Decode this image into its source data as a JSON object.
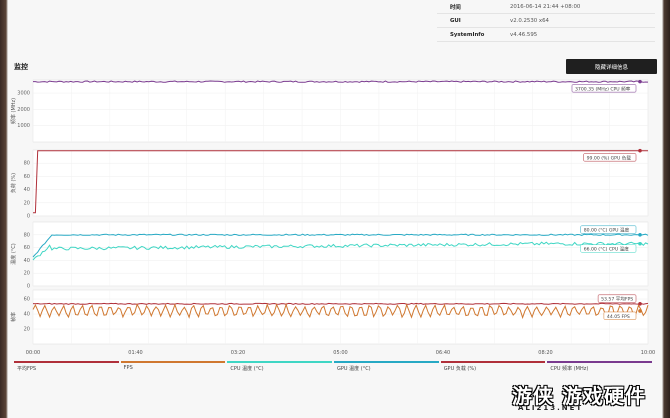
{
  "info": [
    {
      "key": "时间",
      "value": "2016-06-14 21:44 +08:00"
    },
    {
      "key": "GUI",
      "value": "v2.0.2530 x64"
    },
    {
      "key": "SystemInfo",
      "value": "v4.46.595"
    }
  ],
  "section_title": "监控",
  "hide_button_label": "隐藏详细信息",
  "colors": {
    "cpu_freq": "#7a3a8f",
    "gpu_load": "#b0303a",
    "gpu_temp": "#27a9c4",
    "cpu_temp": "#3fd6c4",
    "fps": "#d07830",
    "avg_fps": "#b0303a"
  },
  "chart_data": [
    {
      "type": "line",
      "ylabel": "频率 (MHz)",
      "yticks": [
        1000,
        2000,
        3000
      ],
      "ylim": [
        0,
        3800
      ],
      "series": [
        {
          "name": "CPU 频率",
          "value": 3700,
          "callout": "3700.35 (MHz) CPU 频率"
        }
      ]
    },
    {
      "type": "line",
      "ylabel": "负荷 (%)",
      "yticks": [
        0,
        20,
        40,
        60,
        80
      ],
      "ylim": [
        0,
        100
      ],
      "series": [
        {
          "name": "GPU 负载",
          "value": 99,
          "callout": "99.00 (%) GPU 负载"
        }
      ]
    },
    {
      "type": "line",
      "ylabel": "温度 (°C)",
      "yticks": [
        0,
        20,
        40,
        60,
        80
      ],
      "ylim": [
        0,
        100
      ],
      "series": [
        {
          "name": "GPU 温度",
          "value": 80,
          "callout": "80.00 (°C) GPU 温度"
        },
        {
          "name": "CPU 温度",
          "value": 66,
          "callout": "66.00 (°C) CPU 温度"
        }
      ]
    },
    {
      "type": "line",
      "ylabel": "帧率",
      "yticks": [
        20,
        40,
        60
      ],
      "ylim": [
        0,
        72
      ],
      "series": [
        {
          "name": "平均FPS",
          "value": 53.57,
          "callout": "53.57 平均FPS"
        },
        {
          "name": "FPS",
          "value": 44.05,
          "callout": "44.05 FPS"
        }
      ]
    }
  ],
  "xticks": [
    "00:00",
    "01:40",
    "03:20",
    "05:00",
    "06:40",
    "08:20",
    "10:00"
  ],
  "legend": [
    {
      "label": "平均FPS",
      "color": "#b0303a"
    },
    {
      "label": "FPS",
      "color": "#d07830"
    },
    {
      "label": "CPU 温度 (°C)",
      "color": "#3fd6c4"
    },
    {
      "label": "GPU 温度 (°C)",
      "color": "#27a9c4"
    },
    {
      "label": "GPU 负载 (%)",
      "color": "#b0303a"
    },
    {
      "label": "CPU 频率 (MHz)",
      "color": "#7a3a8f"
    }
  ],
  "watermark": {
    "main": "游侠 游戏硬件",
    "url": "ALI213.NET"
  }
}
